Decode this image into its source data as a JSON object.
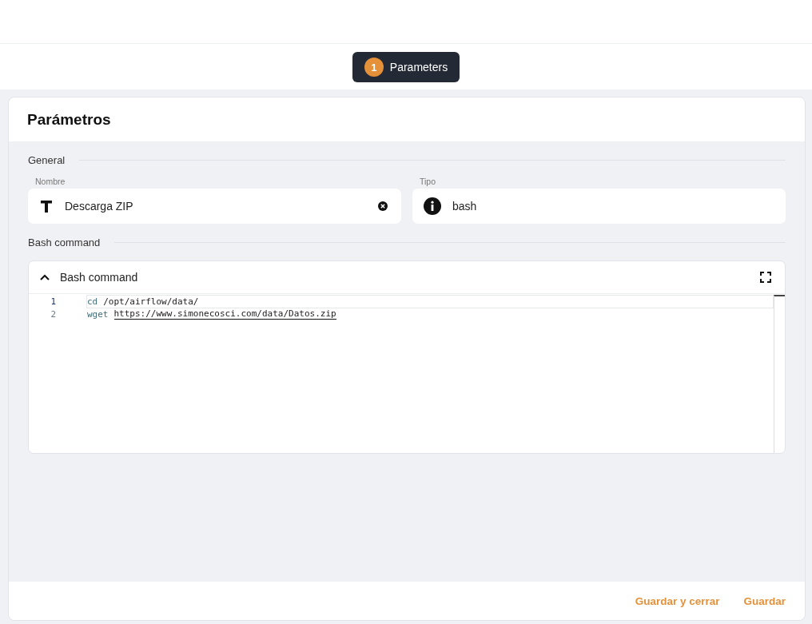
{
  "steps": [
    {
      "number": "1",
      "label": "Parameters",
      "selected": true
    }
  ],
  "card": {
    "title": "Parámetros",
    "sections": [
      {
        "title": "General"
      },
      {
        "title": "Bash command"
      }
    ],
    "fields": [
      {
        "label": "Nombre",
        "value": "Descarga ZIP",
        "kind": "text",
        "clearable": true
      },
      {
        "label": "Tipo",
        "value": "bash",
        "kind": "info",
        "clearable": false
      }
    ],
    "editor": {
      "title": "Bash command",
      "expanded": true,
      "lines": [
        {
          "number": "1",
          "command": "cd",
          "argument": "/opt/airflow/data/",
          "link": false,
          "current": true
        },
        {
          "number": "2",
          "command": "wget",
          "argument": "https://www.simonecosci.com/data/Datos.zip",
          "link": true,
          "current": false
        }
      ]
    },
    "buttons": [
      "Guardar y cerrar",
      "Guardar"
    ]
  }
}
